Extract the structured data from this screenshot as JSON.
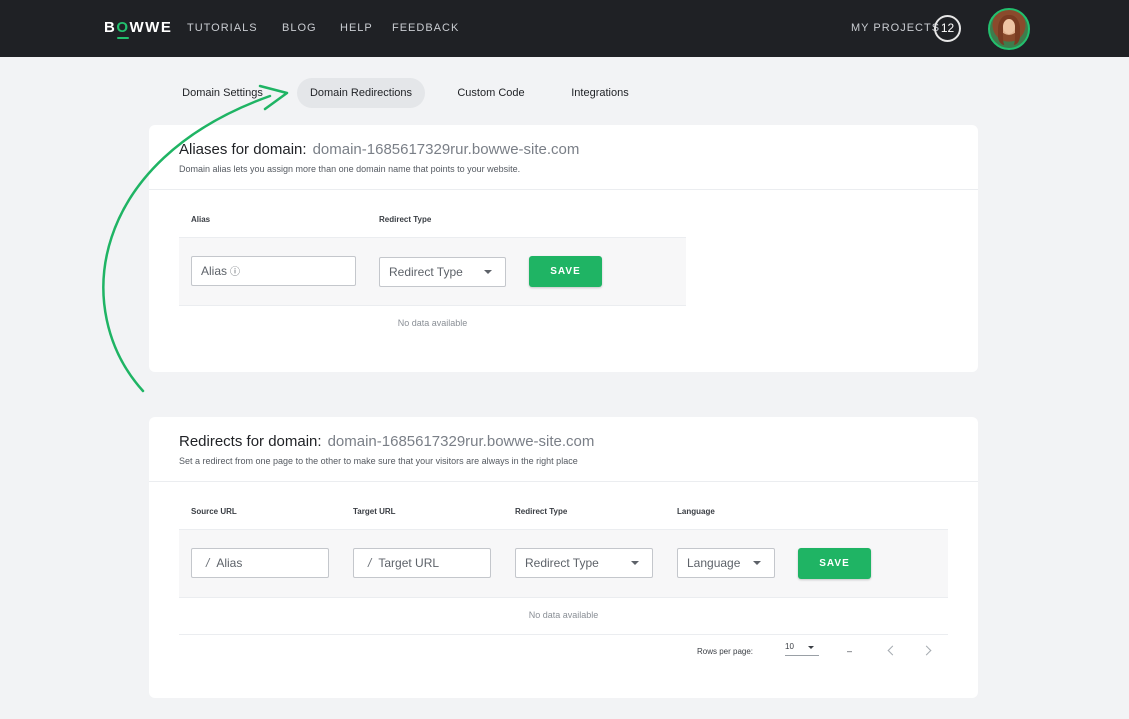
{
  "brand": {
    "logo_prefix": "B",
    "logo_o": "O",
    "logo_suffix": "WWE",
    "accent_color": "#22c06e"
  },
  "nav": {
    "tutorials": "TUTORIALS",
    "blog": "BLOG",
    "help": "HELP",
    "feedback": "FEEDBACK",
    "my_projects": "MY PROJECTS",
    "project_count": "12"
  },
  "tabs": {
    "domain_settings": "Domain Settings",
    "domain_redirections": "Domain Redirections",
    "custom_code": "Custom Code",
    "integrations": "Integrations",
    "active": "Domain Redirections"
  },
  "aliases": {
    "title": "Aliases for domain:",
    "domain": "domain-1685617329rur.bowwe-site.com",
    "subtitle": "Domain alias lets you assign more than one domain name that points to your website.",
    "col_alias": "Alias",
    "col_redirect_type": "Redirect Type",
    "alias_placeholder": "Alias",
    "info_icon": "ⓘ",
    "redirect_type_select": "Redirect Type",
    "save": "SAVE",
    "no_data": "No data available"
  },
  "redirects": {
    "title": "Redirects for domain:",
    "domain": "domain-1685617329rur.bowwe-site.com",
    "subtitle": "Set a redirect from one page to the other to make sure that your visitors are always in the right place",
    "col_source": "Source URL",
    "col_target": "Target URL",
    "col_redirect_type": "Redirect Type",
    "col_language": "Language",
    "source_slash": "/",
    "source_placeholder": "Alias",
    "target_slash": "/",
    "target_placeholder": "Target URL",
    "redirect_type_select": "Redirect Type",
    "language_select": "Language",
    "save": "SAVE",
    "no_data": "No data available",
    "rows_per_page_label": "Rows per page:",
    "rows_per_page_value": "10",
    "page_range": "–"
  },
  "colors": {
    "topbar": "#1f2125",
    "button": "#1fb464",
    "background": "#f2f3f5"
  }
}
